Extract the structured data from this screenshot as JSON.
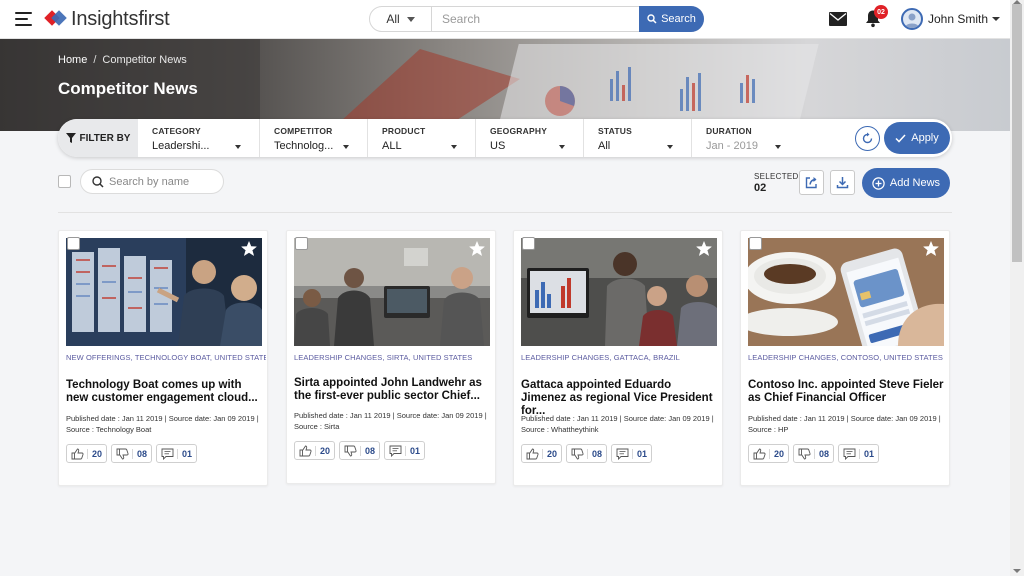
{
  "app": {
    "logo_text": "Insightsfirst",
    "brand_colors": {
      "primary": "#3d6ab4",
      "logo_red": "#e02127",
      "logo_blue": "#3d6ab4"
    }
  },
  "topbar": {
    "search": {
      "category": "All",
      "placeholder": "Search",
      "button_label": "Search"
    },
    "notifications_count": "02",
    "user_name": "John Smith"
  },
  "hero": {
    "breadcrumb": {
      "home": "Home",
      "separator": "/",
      "current": "Competitor News"
    },
    "title": "Competitor News"
  },
  "filters": {
    "label": "FILTER BY",
    "columns": [
      {
        "label": "CATEGORY",
        "value": "Leadershi..."
      },
      {
        "label": "COMPETITOR",
        "value": "Technolog..."
      },
      {
        "label": "PRODUCT",
        "value": "ALL"
      },
      {
        "label": "GEOGRAPHY",
        "value": "US"
      },
      {
        "label": "STATUS",
        "value": "All"
      },
      {
        "label": "DURATION",
        "value": "Jan - 2019"
      }
    ],
    "apply_label": "Apply"
  },
  "toolbar": {
    "name_search_placeholder": "Search by name",
    "selected_label": "SELECTED",
    "selected_count": "02",
    "add_news_label": "Add News"
  },
  "cards": [
    {
      "tags": "NEW OFFERINGS, TECHNOLOGY BOAT, UNITED STATES",
      "title": "Technology Boat comes up with new customer engagement cloud...",
      "meta_line1": "Published date : Jan 11 2019 | Source date: Jan 09 2019 |",
      "meta_line2": "Source : Technology Boat",
      "likes": "20",
      "dislikes": "08",
      "comments": "01"
    },
    {
      "tags": "LEADERSHIP CHANGES, SIRTA, UNITED STATES",
      "title": "Sirta appointed John Landwehr as the first-ever public sector Chief...",
      "meta_line1": "Published date : Jan 11 2019 | Source date: Jan 09 2019 |",
      "meta_line2": "Source : Sirta",
      "likes": "20",
      "dislikes": "08",
      "comments": "01"
    },
    {
      "tags": "LEADERSHIP CHANGES, GATTACA, BRAZIL",
      "title": "Gattaca appointed Eduardo Jimenez as regional Vice President for...",
      "meta_line1": "Published date : Jan 11 2019 | Source date: Jan 09 2019 |",
      "meta_line2": "Source : Whattheythink",
      "likes": "20",
      "dislikes": "08",
      "comments": "01"
    },
    {
      "tags": "LEADERSHIP CHANGES, CONTOSO, UNITED STATES",
      "title": "Contoso Inc. appointed Steve Fieler as Chief Financial Officer",
      "meta_line1": "Published date : Jan 11 2019 | Source date: Jan 09 2019 |",
      "meta_line2": "Source : HP",
      "likes": "20",
      "dislikes": "08",
      "comments": "01"
    }
  ]
}
